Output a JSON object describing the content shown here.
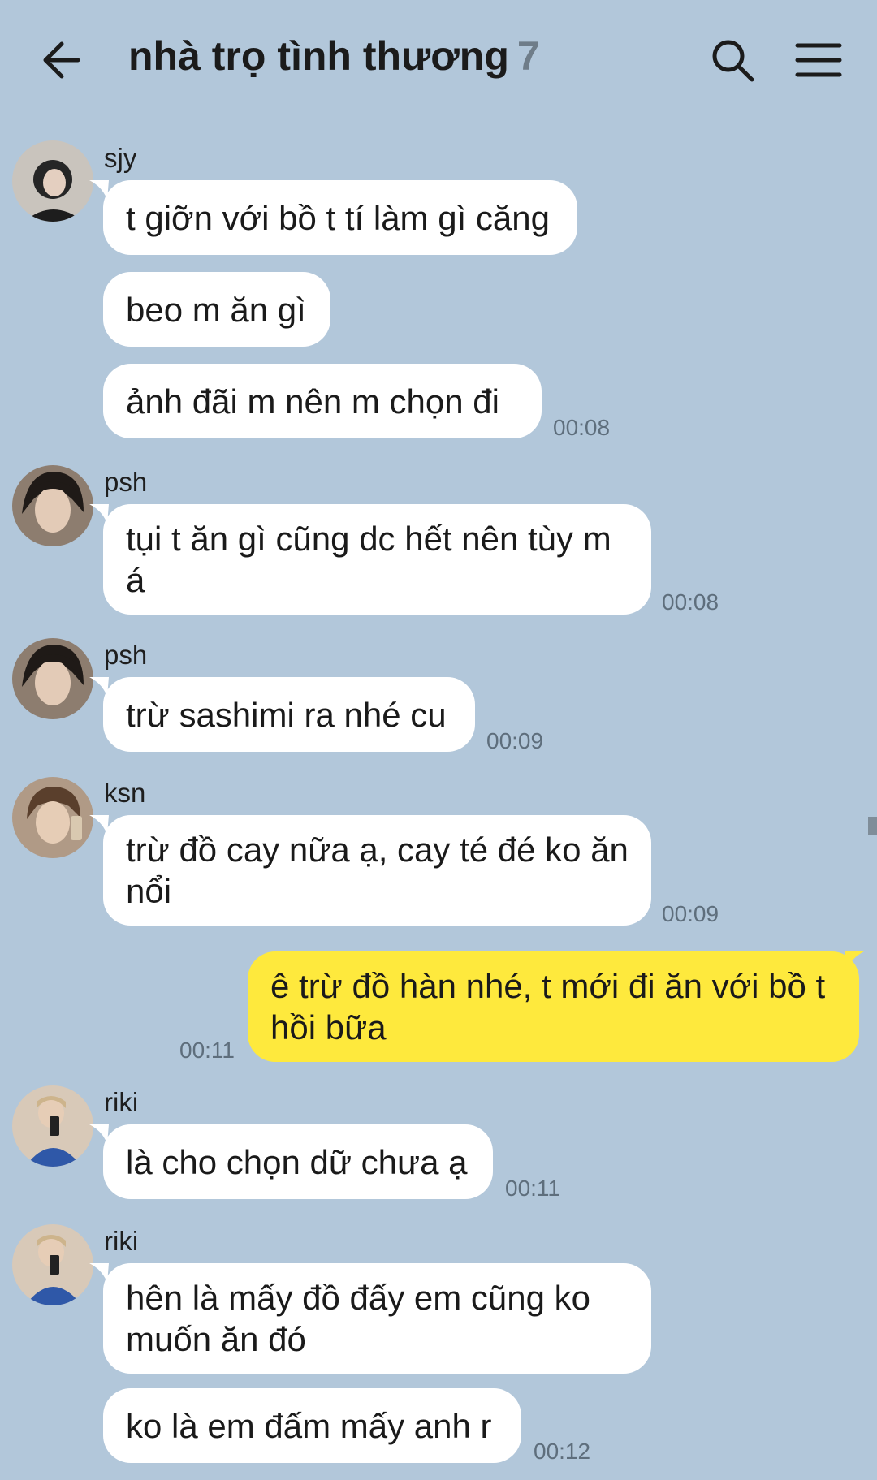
{
  "header": {
    "title": "nhà trọ tình thương",
    "member_count": "7",
    "back_icon": "arrow-left-icon",
    "search_icon": "search-icon",
    "menu_icon": "hamburger-menu-icon"
  },
  "colors": {
    "chat_background": "#b2c7da",
    "incoming_bubble": "#ffffff",
    "outgoing_bubble": "#fee93d",
    "timestamp": "#5e6e7c"
  },
  "messages": [
    {
      "sender": "sjy",
      "text": "t giỡn với bồ t tí làm gì căng",
      "time": ""
    },
    {
      "sender": "",
      "text": "beo m ăn gì",
      "time": ""
    },
    {
      "sender": "",
      "text": "ảnh đãi m nên m chọn đi",
      "time": "00:08"
    },
    {
      "sender": "psh",
      "text": "tụi t ăn gì cũng dc hết nên tùy m á",
      "time": "00:08"
    },
    {
      "sender": "psh",
      "text": "trừ sashimi ra nhé cu",
      "time": "00:09"
    },
    {
      "sender": "ksn",
      "text": "trừ đồ cay nữa ạ, cay té đé ko ăn nổi",
      "time": "00:09"
    },
    {
      "sender": "",
      "text": "ê trừ đồ hàn nhé, t mới đi ăn với bồ t hồi bữa",
      "time": "00:11"
    },
    {
      "sender": "riki",
      "text": "là cho chọn dữ chưa ạ",
      "time": "00:11"
    },
    {
      "sender": "riki",
      "text": "hên là mấy đồ đấy em cũng ko muốn ăn đó",
      "time": ""
    },
    {
      "sender": "",
      "text": "ko là em đấm mấy anh r",
      "time": "00:12"
    }
  ]
}
